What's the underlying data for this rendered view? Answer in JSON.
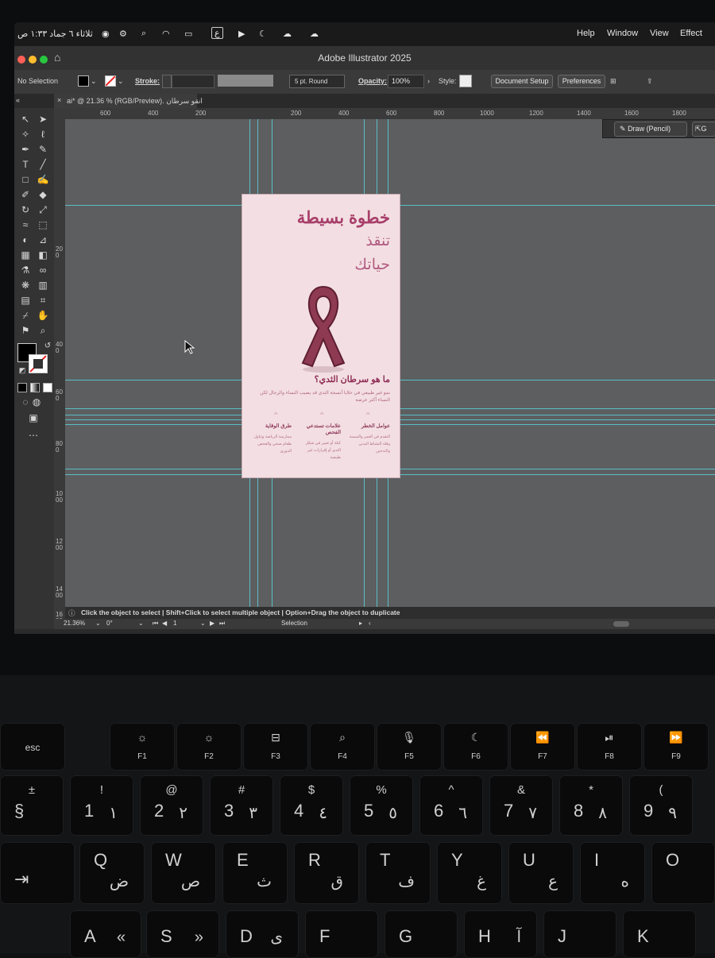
{
  "menubar": {
    "clock": "ثلاثاء ٦ جماد ١:٣٣ ص",
    "input_source": "ع",
    "menus": [
      "Help",
      "Window",
      "View",
      "Effect"
    ]
  },
  "app": {
    "title": "Adobe Illustrator 2025"
  },
  "control_bar": {
    "selection_label": "No Selection",
    "stroke_label": "Stroke:",
    "brush_value": "5 pt. Round",
    "opacity_label": "Opacity:",
    "opacity_value": "100%",
    "style_label": "Style:",
    "document_setup": "Document Setup",
    "preferences": "Preferences"
  },
  "document_tab": {
    "close": "×",
    "title": "انقو سرطان .ai* @ 21.36 % (RGB/Preview)"
  },
  "rulers": {
    "horizontal": [
      "600",
      "400",
      "200",
      "200",
      "400",
      "600",
      "800",
      "1000",
      "1200",
      "1400",
      "1600",
      "1800"
    ],
    "vertical": [
      "200",
      "400",
      "600",
      "800",
      "1000",
      "1200",
      "1400",
      "1600"
    ]
  },
  "draw_panel": {
    "label": "Draw (Pencil)",
    "extra": "G"
  },
  "artboard": {
    "headline_1": "خطوة بسيطة",
    "headline_2": "تنقذ",
    "headline_3": "حياتك",
    "question": "ما هو سرطان الثدي؟",
    "paragraph": "نمو غير طبيعي في خلايا أنسجة الثدي قد يصيب النساء والرجال لكن النساء أكثر عرضة",
    "columns": [
      {
        "title": "طرق الوقاية",
        "body": "ممارسة الرياضة وتناول طعام صحي والفحص الدوري"
      },
      {
        "title": "علامات تستدعي الفحص",
        "body": "كتلة أو تغيير في شكل الثدي أو إفرازات غير طبيعية"
      },
      {
        "title": "عوامل الخطر",
        "body": "التقدم في العمر والسمنة وقلة النشاط البدني والتدخين"
      }
    ]
  },
  "status_bar": {
    "hint": "Click the object to select  |  Shift+Click to select multiple object  |  Option+Drag the object to duplicate"
  },
  "bottom_bar": {
    "zoom": "21.36%",
    "rotation": "0°",
    "artboard_number": "1",
    "mode": "Selection"
  },
  "keyboard": {
    "function_keys": [
      {
        "label": "esc"
      },
      {
        "label": "F1",
        "icon": "☼"
      },
      {
        "label": "F2",
        "icon": "☼"
      },
      {
        "label": "F3",
        "icon": "⊟"
      },
      {
        "label": "F4",
        "icon": "⌕"
      },
      {
        "label": "F5",
        "icon": "🎙"
      },
      {
        "label": "F6",
        "icon": "☾"
      },
      {
        "label": "F7",
        "icon": "⏪"
      },
      {
        "label": "F8",
        "icon": "⏯"
      },
      {
        "label": "F9",
        "icon": "⏩"
      }
    ],
    "number_row": [
      {
        "top": "±",
        "lat": "§",
        "ar": ""
      },
      {
        "top": "!",
        "lat": "1",
        "ar": "١"
      },
      {
        "top": "@",
        "lat": "2",
        "ar": "٢"
      },
      {
        "top": "#",
        "lat": "3",
        "ar": "٣"
      },
      {
        "top": "$",
        "lat": "4",
        "ar": "٤"
      },
      {
        "top": "%",
        "lat": "5",
        "ar": "٥"
      },
      {
        "top": "^",
        "lat": "6",
        "ar": "٦"
      },
      {
        "top": "&",
        "lat": "7",
        "ar": "٧"
      },
      {
        "top": "*",
        "lat": "8",
        "ar": "٨"
      },
      {
        "top": "(",
        "lat": "9",
        "ar": "٩"
      }
    ],
    "q_row": [
      {
        "lat": "⇥",
        "ar": ""
      },
      {
        "lat": "Q",
        "ar": "ض"
      },
      {
        "lat": "W",
        "ar": "ص"
      },
      {
        "lat": "E",
        "ar": "ث"
      },
      {
        "lat": "R",
        "ar": "ق"
      },
      {
        "lat": "T",
        "ar": "ف"
      },
      {
        "lat": "Y",
        "ar": "غ"
      },
      {
        "lat": "U",
        "ar": "ع"
      },
      {
        "lat": "I",
        "ar": "ه"
      },
      {
        "lat": "O",
        "ar": ""
      }
    ],
    "a_row": [
      {
        "lat": "A",
        "ar": "«"
      },
      {
        "lat": "S",
        "ar": "»"
      },
      {
        "lat": "D",
        "ar": "ى"
      },
      {
        "lat": "F",
        "ar": ""
      },
      {
        "lat": "G",
        "ar": ""
      },
      {
        "lat": "H",
        "ar": "آ"
      },
      {
        "lat": "J",
        "ar": ""
      },
      {
        "lat": "K",
        "ar": ""
      }
    ]
  }
}
